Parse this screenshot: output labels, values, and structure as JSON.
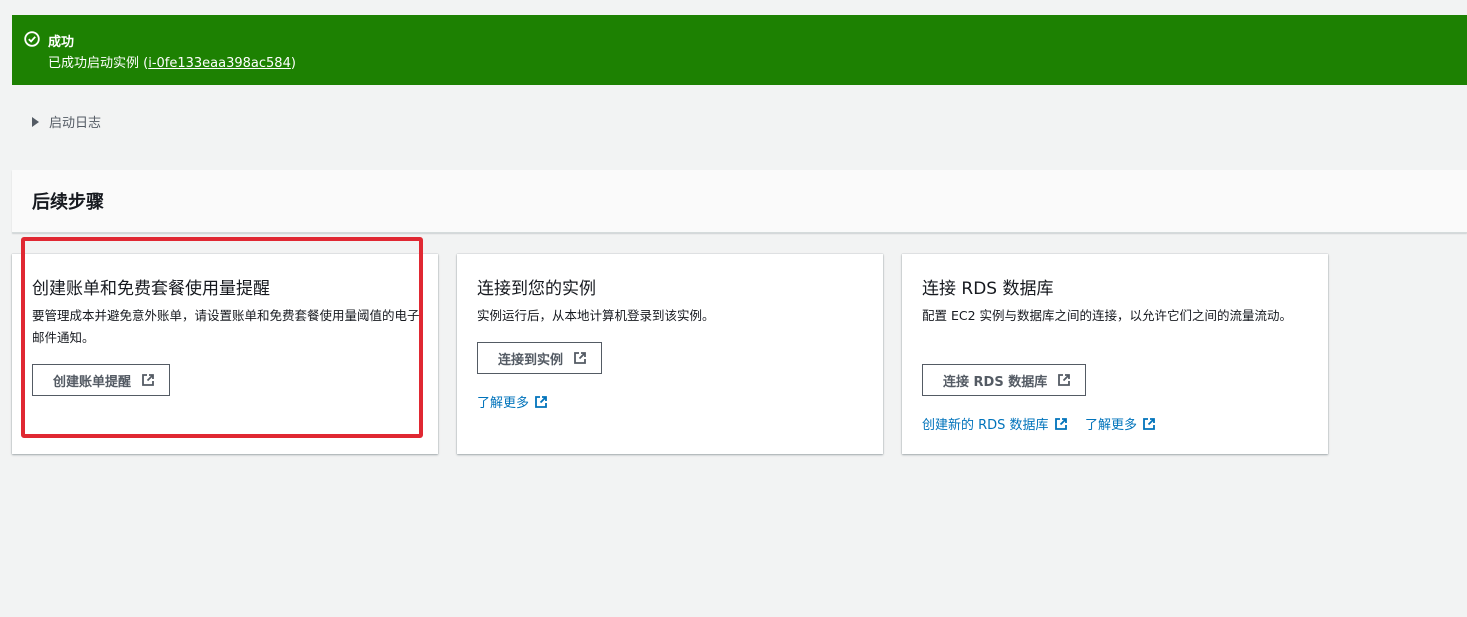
{
  "flash": {
    "title": "成功",
    "message_prefix": "已成功启动实例 (",
    "instance_id": "i-0fe133eaa398ac584",
    "message_suffix": ")",
    "icon": "check-circle-icon",
    "color": "#1d8102"
  },
  "launch_log": {
    "label": "启动日志",
    "icon": "caret-right-icon"
  },
  "next_steps": {
    "title": "后续步骤"
  },
  "cards": [
    {
      "title": "创建账单和免费套餐使用量提醒",
      "description": "要管理成本并避免意外账单，请设置账单和免费套餐使用量阈值的电子邮件通知。",
      "button": "创建账单提醒"
    },
    {
      "title": "连接到您的实例",
      "description": "实例运行后，从本地计算机登录到该实例。",
      "button": "连接到实例",
      "link": "了解更多"
    },
    {
      "title": "连接 RDS 数据库",
      "description": "配置 EC2 实例与数据库之间的连接，以允许它们之间的流量流动。",
      "button": "连接 RDS 数据库",
      "links": [
        "创建新的 RDS 数据库",
        "了解更多"
      ]
    }
  ],
  "colors": {
    "link": "#0073bb",
    "highlight": "#e02832",
    "button_border": "#545b64"
  }
}
